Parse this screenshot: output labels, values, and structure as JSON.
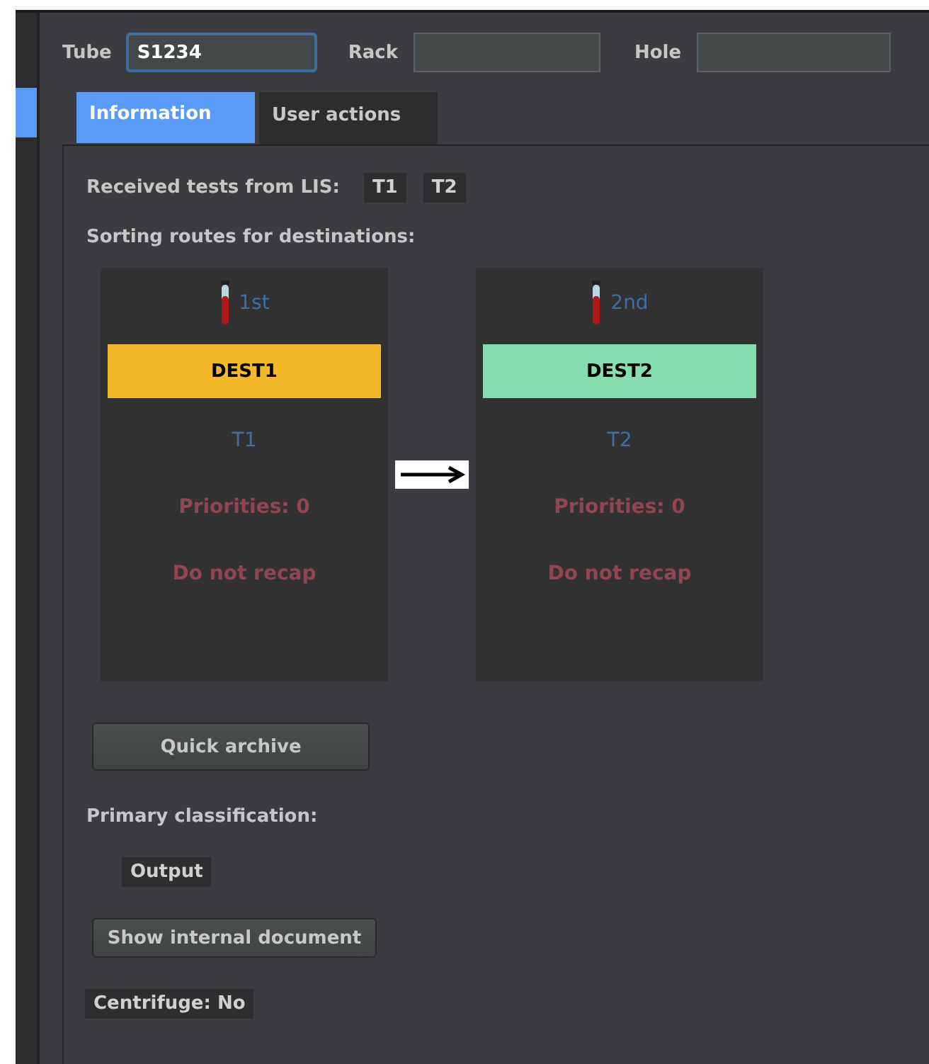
{
  "fields": [
    {
      "label": "Tube",
      "value": "S1234",
      "focused": true
    },
    {
      "label": "Rack",
      "focused": false
    },
    {
      "label": "Hole",
      "focused": false
    }
  ],
  "tabs": [
    {
      "label": "Information",
      "selected": true
    },
    {
      "label": "User actions",
      "selected": false
    }
  ],
  "received_tests": {
    "label": "Received tests from LIS:",
    "tests": [
      "T1",
      "T2"
    ]
  },
  "routes": {
    "label": "Sorting routes for destinations:",
    "destinations": [
      {
        "order": "1st",
        "name": "DEST1",
        "color": "#f4b82b",
        "test": "T1",
        "priorities": "Priorities: 0",
        "recap": "Do not recap"
      },
      {
        "order": "2nd",
        "name": "DEST2",
        "color": "#86ddb0",
        "test": "T2",
        "priorities": "Priorities: 0",
        "recap": "Do not recap"
      }
    ]
  },
  "quick_archive_button": "Quick archive",
  "primary_classification": {
    "label": "Primary classification:",
    "value": "Output"
  },
  "show_document_button": "Show internal document",
  "centrifuge": "Centrifuge: No"
}
